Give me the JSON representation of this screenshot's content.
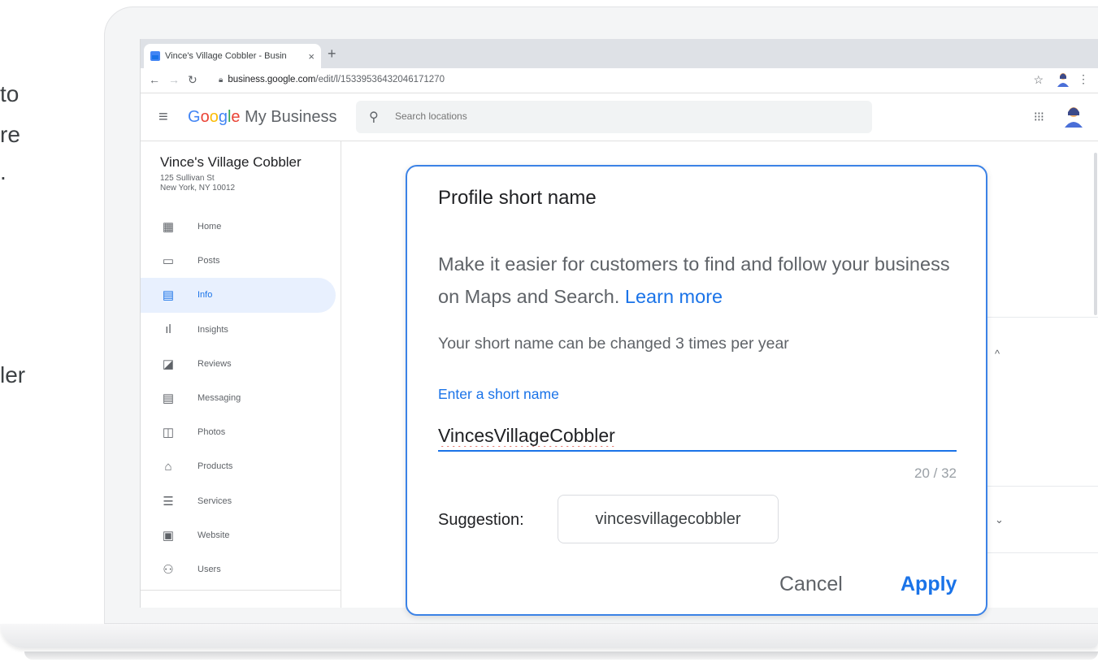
{
  "background_text": [
    "to",
    "re",
    ".",
    "ler"
  ],
  "browser": {
    "tab_title": "Vince's Village Cobbler - Busin",
    "tab_close": "×",
    "new_tab": "+",
    "url_domain": "business.google.com",
    "url_path": "/edit/l/15339536432046171270"
  },
  "header": {
    "logo_google": [
      "G",
      "o",
      "o",
      "g",
      "l",
      "e"
    ],
    "logo_product": "My Business",
    "search_placeholder": "Search locations"
  },
  "sidebar": {
    "business_name": "Vince's Village Cobbler",
    "address_line1": "125 Sullivan St",
    "address_line2": "New York, NY 10012",
    "items": [
      {
        "label": "Home",
        "icon": "home-icon",
        "glyph": "▦"
      },
      {
        "label": "Posts",
        "icon": "posts-icon",
        "glyph": "▭"
      },
      {
        "label": "Info",
        "icon": "store-icon",
        "glyph": "▤",
        "active": true
      },
      {
        "label": "Insights",
        "icon": "insights-icon",
        "glyph": "ıl"
      },
      {
        "label": "Reviews",
        "icon": "reviews-icon",
        "glyph": "◪"
      },
      {
        "label": "Messaging",
        "icon": "messaging-icon",
        "glyph": "▤"
      },
      {
        "label": "Photos",
        "icon": "photos-icon",
        "glyph": "◫"
      },
      {
        "label": "Products",
        "icon": "products-icon",
        "glyph": "⌂"
      },
      {
        "label": "Services",
        "icon": "services-icon",
        "glyph": "☰"
      },
      {
        "label": "Website",
        "icon": "website-icon",
        "glyph": "▣"
      },
      {
        "label": "Users",
        "icon": "users-icon",
        "glyph": "⚇"
      }
    ]
  },
  "dialog": {
    "title": "Profile short name",
    "description": "Make it easier for customers to find and follow your business on Maps and Search.",
    "learn_more": "Learn more",
    "note": "Your short name can be changed 3 times per year",
    "field_label": "Enter a short name",
    "field_value": "VincesVillageCobbler",
    "counter": "20 / 32",
    "suggestion_label": "Suggestion:",
    "suggestion_value": "vincesvillagecobbler",
    "cancel": "Cancel",
    "apply": "Apply"
  },
  "colors": {
    "accent": "#1a73e8",
    "dialog_border": "#3b82e6",
    "active_nav_bg": "#e8f0fe"
  }
}
